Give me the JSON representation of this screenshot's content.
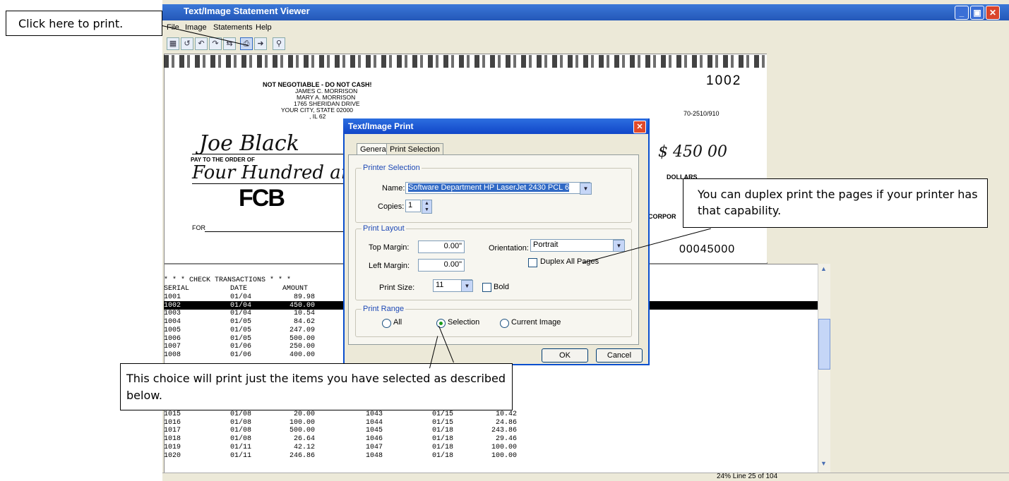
{
  "window": {
    "title": "Text/Image Statement Viewer",
    "menus": [
      "File",
      "Image",
      "Statements",
      "Help"
    ]
  },
  "check": {
    "number": "1002",
    "not_negotiable": "NOT NEGOTIABLE - DO NOT CASH!",
    "owner_lines": [
      "JAMES C. MORRISON",
      "MARY A. MORRISON",
      "1765 SHERIDAN DRIVE",
      "YOUR CITY, STATE  02000",
      ", IL  62"
    ],
    "routing": "70-2510/910",
    "payee": "Joe Black",
    "pay_to_label": "PAY TO THE ORDER OF",
    "amount_words": "Four Hundred and",
    "amount": "$ 450 00",
    "dollars_label": "DOLLARS",
    "bank_logo": "FCB",
    "for_label": "FOR",
    "corp_label": "CORPOR",
    "micr": "00045000"
  },
  "transactions": {
    "header1": "* * * CHECK TRANSACTIONS * * *",
    "columns": [
      "SERIAL",
      "DATE",
      "AMOUNT"
    ],
    "rows_left": [
      [
        "1001",
        "01/04",
        "89.98"
      ],
      [
        "1002",
        "01/04",
        "450.00"
      ],
      [
        "1003",
        "01/04",
        "10.54"
      ],
      [
        "1004",
        "01/05",
        "84.62"
      ],
      [
        "1005",
        "01/05",
        "247.09"
      ],
      [
        "1006",
        "01/05",
        "500.00"
      ],
      [
        "1007",
        "01/06",
        "250.00"
      ],
      [
        "1008",
        "01/06",
        "400.00"
      ]
    ],
    "rows_bottom": [
      [
        "1015",
        "01/08",
        "20.00",
        "1043",
        "01/15",
        "10.42"
      ],
      [
        "1016",
        "01/08",
        "100.00",
        "1044",
        "01/15",
        "24.86"
      ],
      [
        "1017",
        "01/08",
        "500.00",
        "1045",
        "01/18",
        "243.86"
      ],
      [
        "1018",
        "01/08",
        "26.64",
        "1046",
        "01/18",
        "29.46"
      ],
      [
        "1019",
        "01/11",
        "42.12",
        "1047",
        "01/18",
        "100.00"
      ],
      [
        "1020",
        "01/11",
        "246.86",
        "1048",
        "01/18",
        "100.00"
      ]
    ]
  },
  "status": {
    "text": "24% Line  25 of 104"
  },
  "dialog": {
    "title": "Text/Image Print",
    "tabs": [
      "General",
      "Print Selection"
    ],
    "printer_group": "Printer Selection",
    "name_label": "Name:",
    "name_value": "Software Department HP LaserJet 2430 PCL 6",
    "copies_label": "Copies:",
    "copies_value": "1",
    "layout_group": "Print Layout",
    "top_margin_label": "Top Margin:",
    "top_margin_value": "0.00\"",
    "orientation_label": "Orientation:",
    "orientation_value": "Portrait",
    "left_margin_label": "Left Margin:",
    "left_margin_value": "0.00\"",
    "duplex_label": "Duplex All Pages",
    "print_size_label": "Print Size:",
    "print_size_value": "11",
    "bold_label": "Bold",
    "range_group": "Print Range",
    "range_all": "All",
    "range_selection": "Selection",
    "range_current": "Current Image",
    "ok": "OK",
    "cancel": "Cancel"
  },
  "callouts": {
    "print": "Click here to print.",
    "duplex": "You can duplex print the pages if your printer has that capability.",
    "selection": "This choice will print just the items you have selected as described below."
  }
}
